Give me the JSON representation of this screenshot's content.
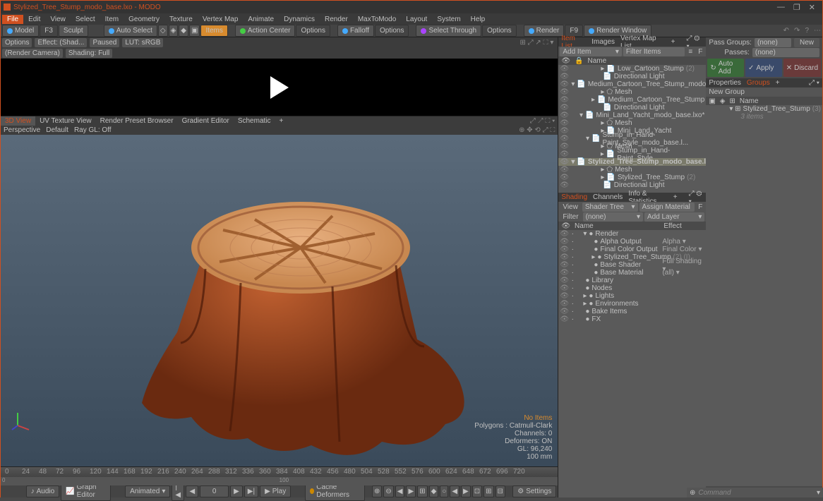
{
  "title": "Stylized_Tree_Stump_modo_base.lxo - MODO",
  "win": {
    "min": "—",
    "max": "❐",
    "close": "✕"
  },
  "menu": [
    "File",
    "Edit",
    "View",
    "Select",
    "Item",
    "Geometry",
    "Texture",
    "Vertex Map",
    "Animate",
    "Dynamics",
    "Render",
    "MaxToModo",
    "Layout",
    "System",
    "Help"
  ],
  "tb": {
    "model": "Model",
    "f3": "F3",
    "sculpt": "Sculpt",
    "autosel": "Auto Select",
    "items": "Items",
    "action": "Action Center",
    "options": "Options",
    "falloff": "Falloff",
    "options2": "Options",
    "selthrough": "Select Through",
    "options3": "Options",
    "render": "Render",
    "f9": "F9",
    "renderwin": "Render Window"
  },
  "opt": {
    "options": "Options",
    "effect": "Effect: (Shad...",
    "paused": "Paused",
    "lut": "LUT: sRGB",
    "rc": "(Render Camera)",
    "shading": "Shading: Full"
  },
  "viewtabs": [
    "3D View",
    "UV Texture View",
    "Render Preset Browser",
    "Gradient Editor",
    "Schematic",
    "+"
  ],
  "v3": {
    "persp": "Perspective",
    "def": "Default",
    "ray": "Ray GL: Off"
  },
  "stats": {
    "h": "No Items",
    "p": "Polygons : Catmull-Clark",
    "c": "Channels: 0",
    "d": "Deformers: ON",
    "g": "GL: 96,240",
    "m": "100 mm"
  },
  "itempanel": {
    "tabs": [
      "Item List",
      "Images",
      "Vertex Map List",
      "+"
    ],
    "add": "Add Item",
    "filter": "Filter Items",
    "name": "Name"
  },
  "items": [
    {
      "l": 2,
      "t": "▸",
      "n": "Low_Cartoon_Stump",
      "x": "(2)"
    },
    {
      "l": 2,
      "t": "",
      "n": "Directional Light"
    },
    {
      "l": 1,
      "t": "▾",
      "n": "Medium_Cartoon_Tree_Stump_modo_bas..."
    },
    {
      "l": 2,
      "t": "▸",
      "n": "Mesh",
      "i": 1
    },
    {
      "l": 2,
      "t": "▸",
      "n": "Medium_Cartoon_Tree_Stump"
    },
    {
      "l": 2,
      "t": "",
      "n": "Directional Light"
    },
    {
      "l": 1,
      "t": "▾",
      "n": "Mini_Land_Yacht_modo_base.lxo*"
    },
    {
      "l": 2,
      "t": "▸",
      "n": "Mesh",
      "i": 1
    },
    {
      "l": 2,
      "t": "▸",
      "n": "Mini_Land_Yacht"
    },
    {
      "l": 1,
      "t": "▾",
      "n": "Stump_in_Hand-Paint_Style_modo_base.l..."
    },
    {
      "l": 2,
      "t": "▸",
      "n": "Mesh",
      "i": 1
    },
    {
      "l": 2,
      "t": "▸",
      "n": "Stump_in_Hand-Paint_Style"
    },
    {
      "l": 1,
      "t": "▾",
      "n": "Stylized_Tree_Stump_modo_base.l...",
      "sel": 1
    },
    {
      "l": 2,
      "t": "▸",
      "n": "Mesh",
      "i": 1
    },
    {
      "l": 2,
      "t": "▸",
      "n": "Stylized_Tree_Stump",
      "x": "(2)"
    },
    {
      "l": 2,
      "t": "",
      "n": "Directional Light"
    }
  ],
  "shpanel": {
    "tabs": [
      "Shading",
      "Channels",
      "Info & Statistics",
      "+"
    ],
    "view": "View",
    "st": "Shader Tree",
    "am": "Assign Material",
    "filter": "Filter",
    "none": "(none)",
    "al": "Add Layer",
    "name": "Name",
    "effect": "Effect"
  },
  "sh": [
    {
      "l": 0,
      "t": "▾",
      "n": "Render"
    },
    {
      "l": 1,
      "n": "Alpha Output",
      "e": "Alpha"
    },
    {
      "l": 1,
      "n": "Final Color Output",
      "e": "Final Color"
    },
    {
      "l": 1,
      "t": "▸",
      "n": "Stylized_Tree_Stump",
      "x": "(2) (I)"
    },
    {
      "l": 1,
      "n": "Base Shader",
      "e": "Full Shading"
    },
    {
      "l": 1,
      "n": "Base Material",
      "e": "(all)"
    },
    {
      "l": 0,
      "n": "Library"
    },
    {
      "l": 0,
      "n": "Nodes"
    },
    {
      "l": 0,
      "t": "▸",
      "n": "Lights"
    },
    {
      "l": 0,
      "t": "▸",
      "n": "Environments"
    },
    {
      "l": 0,
      "n": "Bake Items"
    },
    {
      "l": 0,
      "n": "FX"
    }
  ],
  "fr": {
    "pass": "Pass Groups:",
    "passes": "Passes:",
    "none": "(none)",
    "new": "New",
    "auto": "Auto Add",
    "apply": "Apply",
    "discard": "Discard",
    "props": "Properties",
    "groups": "Groups",
    "ng": "New Group",
    "name": "Name",
    "item": "Stylized_Tree_Stump",
    "cnt": "(3)",
    "sub": "3 items"
  },
  "bb": {
    "audio": "Audio",
    "ge": "Graph Editor",
    "anim": "Animated",
    "f0": "0",
    "play": "Play",
    "cd": "Cache Deformers",
    "set": "Settings"
  },
  "cmd": "Command",
  "ticks": [
    0,
    24,
    48,
    72,
    96,
    120,
    144,
    168,
    192,
    216,
    240,
    264,
    288,
    312,
    336,
    360,
    384,
    408,
    432,
    456,
    480,
    504,
    528,
    552,
    576,
    600,
    624,
    648,
    672,
    696,
    720
  ]
}
